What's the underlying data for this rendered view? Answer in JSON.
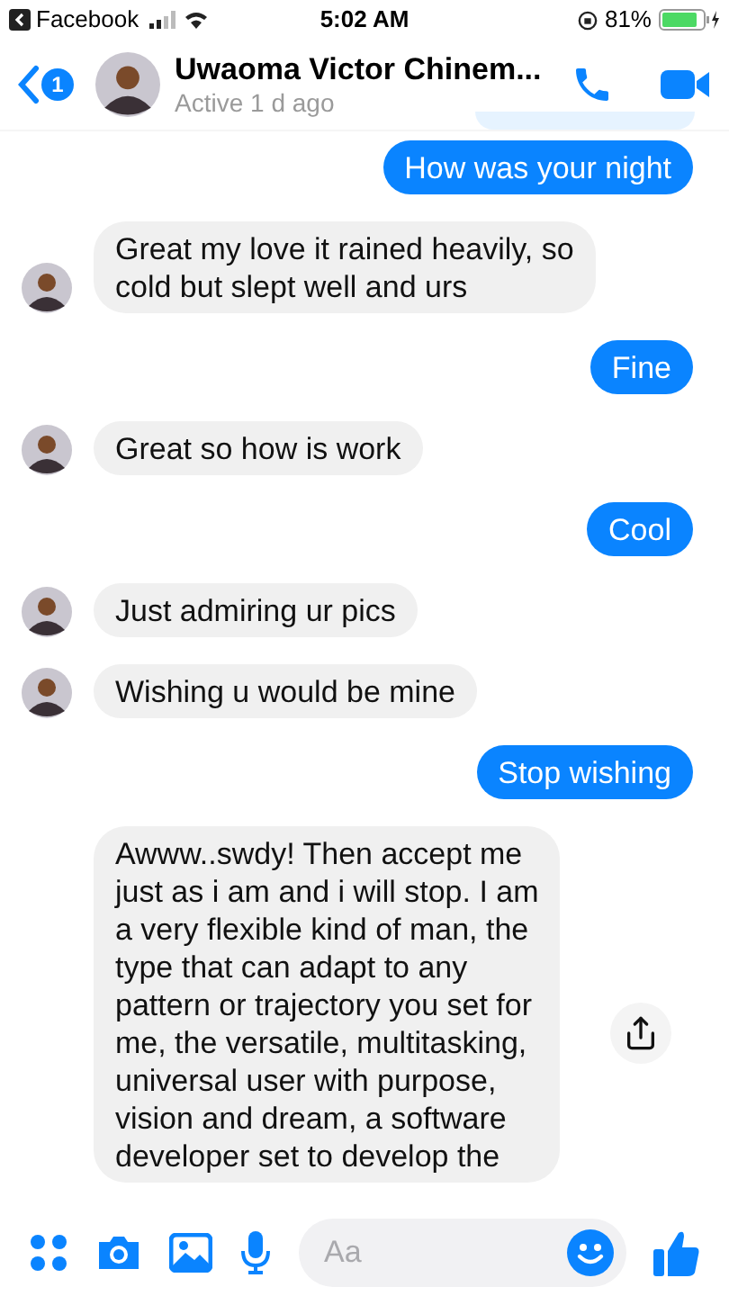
{
  "status_bar": {
    "back_app": "Facebook",
    "time": "5:02 AM",
    "battery": "81%"
  },
  "header": {
    "unread": "1",
    "name": "Uwaoma Victor Chinem...",
    "status": "Active 1 d ago"
  },
  "messages": [
    {
      "kind": "cutoff"
    },
    {
      "kind": "outgoing",
      "lines": [
        "How was your night"
      ]
    },
    {
      "kind": "incoming",
      "avatar": true,
      "lines": [
        "Great my love it rained heavily, so",
        "cold but slept well and urs"
      ]
    },
    {
      "kind": "outgoing",
      "lines": [
        "Fine"
      ]
    },
    {
      "kind": "incoming",
      "avatar": true,
      "lines": [
        "Great so how is work"
      ]
    },
    {
      "kind": "outgoing",
      "lines": [
        "Cool"
      ]
    },
    {
      "kind": "incoming",
      "avatar": true,
      "lines": [
        "Just admiring ur pics"
      ]
    },
    {
      "kind": "incoming",
      "avatar": true,
      "lines": [
        "Wishing u would be mine"
      ]
    },
    {
      "kind": "outgoing",
      "lines": [
        "Stop wishing"
      ]
    },
    {
      "kind": "incoming",
      "avatar": false,
      "share": true,
      "lines": [
        "Awww..swdy! Then accept me",
        "just as i am and i will stop. I am",
        "a very flexible kind of man, the",
        "type that can adapt to any",
        "pattern or trajectory you set for",
        "me, the versatile, multitasking,",
        "universal user with purpose,",
        "vision and dream, a software",
        "developer set to develop the"
      ]
    }
  ],
  "composer": {
    "placeholder": "Aa"
  }
}
